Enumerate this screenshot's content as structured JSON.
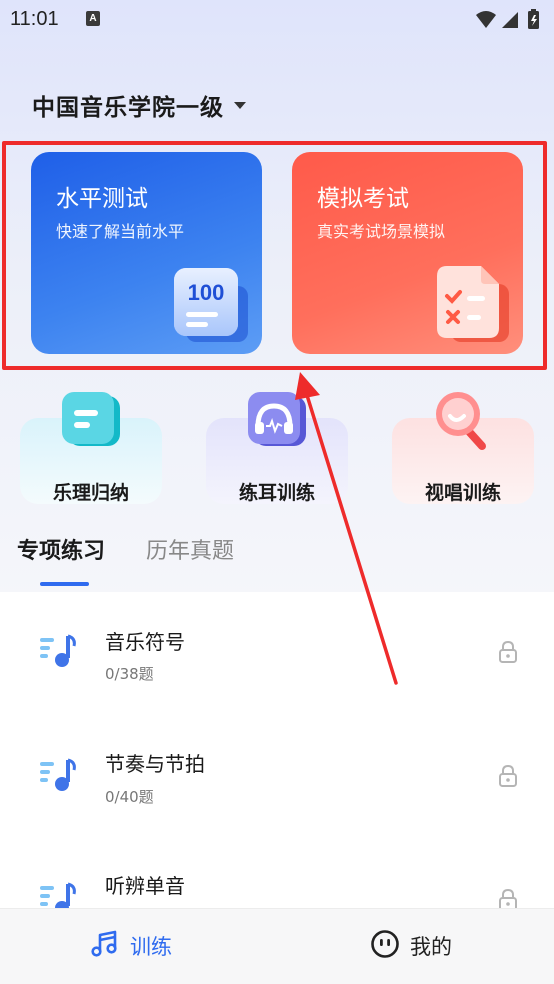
{
  "status_bar": {
    "time": "11:01",
    "notification_glyph": "A"
  },
  "header": {
    "title": "中国音乐学院一级"
  },
  "cards": [
    {
      "title": "水平测试",
      "subtitle": "快速了解当前水平",
      "badge": "100",
      "color": "#2a6ded",
      "icon": "score-100-icon"
    },
    {
      "title": "模拟考试",
      "subtitle": "真实考试场景模拟",
      "color": "#ff5d4d",
      "icon": "exam-checklist-icon"
    }
  ],
  "categories": [
    {
      "label": "乐理归纳",
      "icon": "notes-icon"
    },
    {
      "label": "练耳训练",
      "icon": "headphones-icon"
    },
    {
      "label": "视唱训练",
      "icon": "microphone-icon"
    }
  ],
  "tabs": [
    {
      "label": "专项练习",
      "active": true
    },
    {
      "label": "历年真题",
      "active": false
    }
  ],
  "practice_items": [
    {
      "title": "音乐符号",
      "count": "0/38题",
      "locked": true
    },
    {
      "title": "节奏与节拍",
      "count": "0/40题",
      "locked": true
    },
    {
      "title": "听辨单音",
      "count": "",
      "locked": true
    }
  ],
  "bottom_nav": [
    {
      "label": "训练",
      "icon": "music-note-icon",
      "active": true
    },
    {
      "label": "我的",
      "icon": "face-icon",
      "active": false
    }
  ],
  "colors": {
    "accent": "#2f6bef",
    "highlight": "#ee2b2b"
  }
}
